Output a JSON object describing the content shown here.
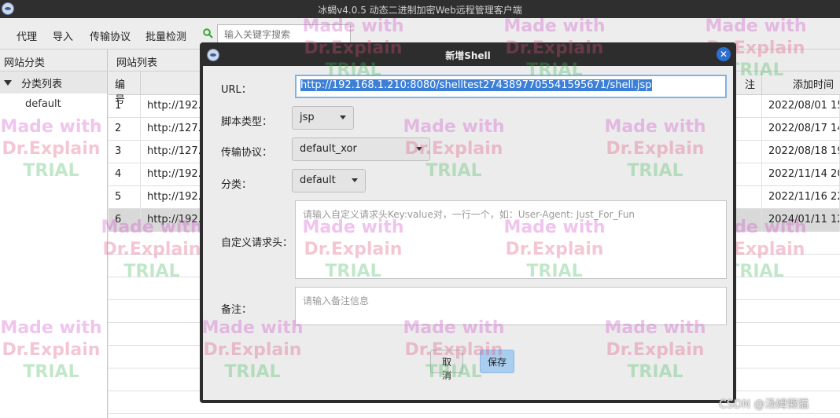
{
  "window": {
    "title": "冰蝎v4.0.5 动态二进制加密Web远程管理客户端"
  },
  "toolbar": {
    "menu": [
      "代理",
      "导入",
      "传输协议",
      "批量检测"
    ],
    "search_placeholder": "输入关键字搜索"
  },
  "sidebar": {
    "header": "网站分类",
    "root_label": "分类列表",
    "children": [
      "default"
    ]
  },
  "main": {
    "header": "网站列表",
    "columns": {
      "id": "编号",
      "remark": "注",
      "added": "添加时间"
    },
    "rows": [
      {
        "id": "1",
        "url": "http://192.",
        "added": "2022/08/01 15"
      },
      {
        "id": "2",
        "url": "http://127.",
        "added": "2022/08/17 14"
      },
      {
        "id": "3",
        "url": "http://127.",
        "added": "2022/08/18 19"
      },
      {
        "id": "4",
        "url": "http://192.",
        "added": "2022/11/14 20"
      },
      {
        "id": "5",
        "url": "http://192.",
        "added": "2022/11/16 22"
      },
      {
        "id": "6",
        "url": "http://192.",
        "added": "2024/01/11 12"
      }
    ],
    "selected_row": "6"
  },
  "dialog": {
    "title": "新增Shell",
    "url_label": "URL：",
    "url_value": "http://192.168.1.210:8080/shelltest2743897705541595671/shell.jsp",
    "script_type_label": "脚本类型：",
    "script_type_value": "jsp",
    "protocol_label": "传输协议：",
    "protocol_value": "default_xor",
    "category_label": "分类：",
    "category_value": "default",
    "headers_label": "自定义请求头：",
    "headers_placeholder": "请输入自定义请求头Key:value对，一行一个，如：User-Agent: Just_For_Fun",
    "remark_label": "备注：",
    "remark_placeholder": "请输入备注信息",
    "cancel_label": "取消",
    "save_label": "保存"
  },
  "watermark": {
    "line1": "Made with",
    "line2": "Dr.Explain",
    "line3": "TRIAL"
  },
  "footer_credit": "CSDN @汤姆懒猫",
  "colors": {
    "accent": "#3c7fd6",
    "close_button": "#2c6fd0",
    "search_icon": "#2eaa2e",
    "save_button": "#a9cdef"
  }
}
